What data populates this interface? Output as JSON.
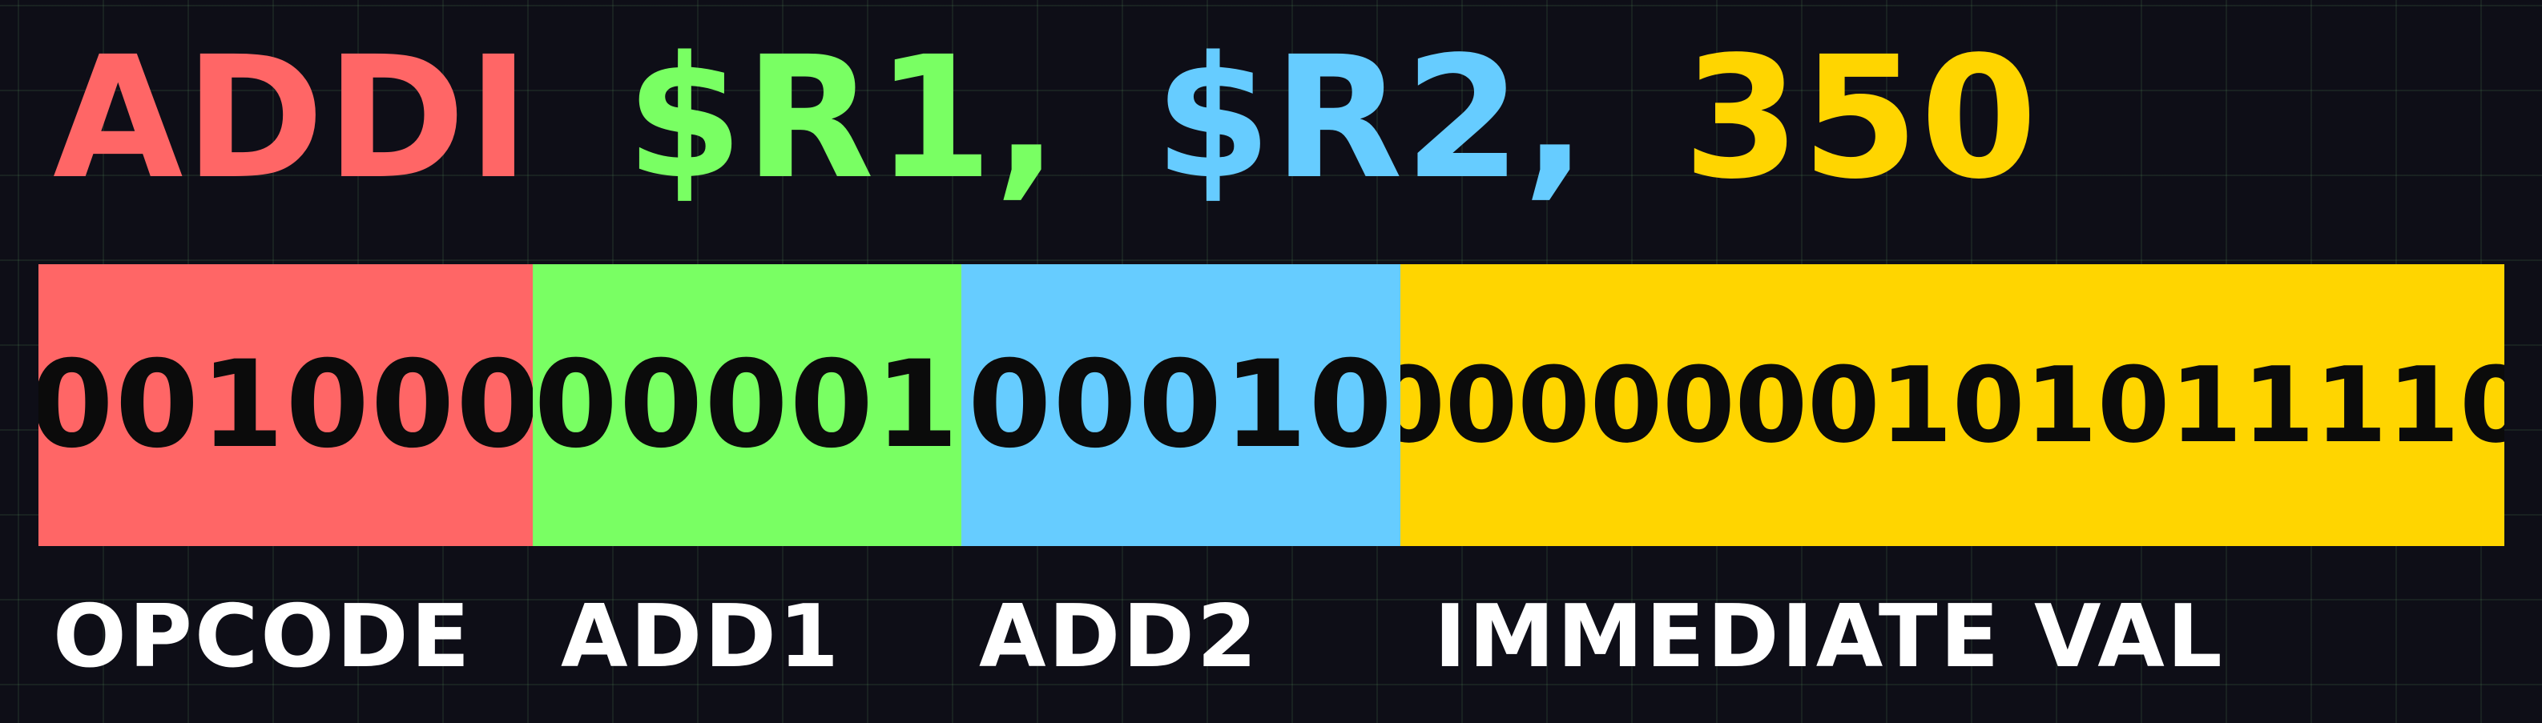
{
  "instruction": {
    "mnemonic": "ADDI",
    "operand1": "$R1,",
    "operand2": "$R2,",
    "immediate": "350"
  },
  "fields": [
    {
      "bits": "001000",
      "label": "OPCODE",
      "color": "#ff6666"
    },
    {
      "bits": "00001",
      "label": "ADD1",
      "color": "#79ff63"
    },
    {
      "bits": "00010",
      "label": "ADD2",
      "color": "#66ccff"
    },
    {
      "bits": "0000000101011110",
      "label": "IMMEDIATE VAL",
      "color": "#ffd500"
    }
  ]
}
